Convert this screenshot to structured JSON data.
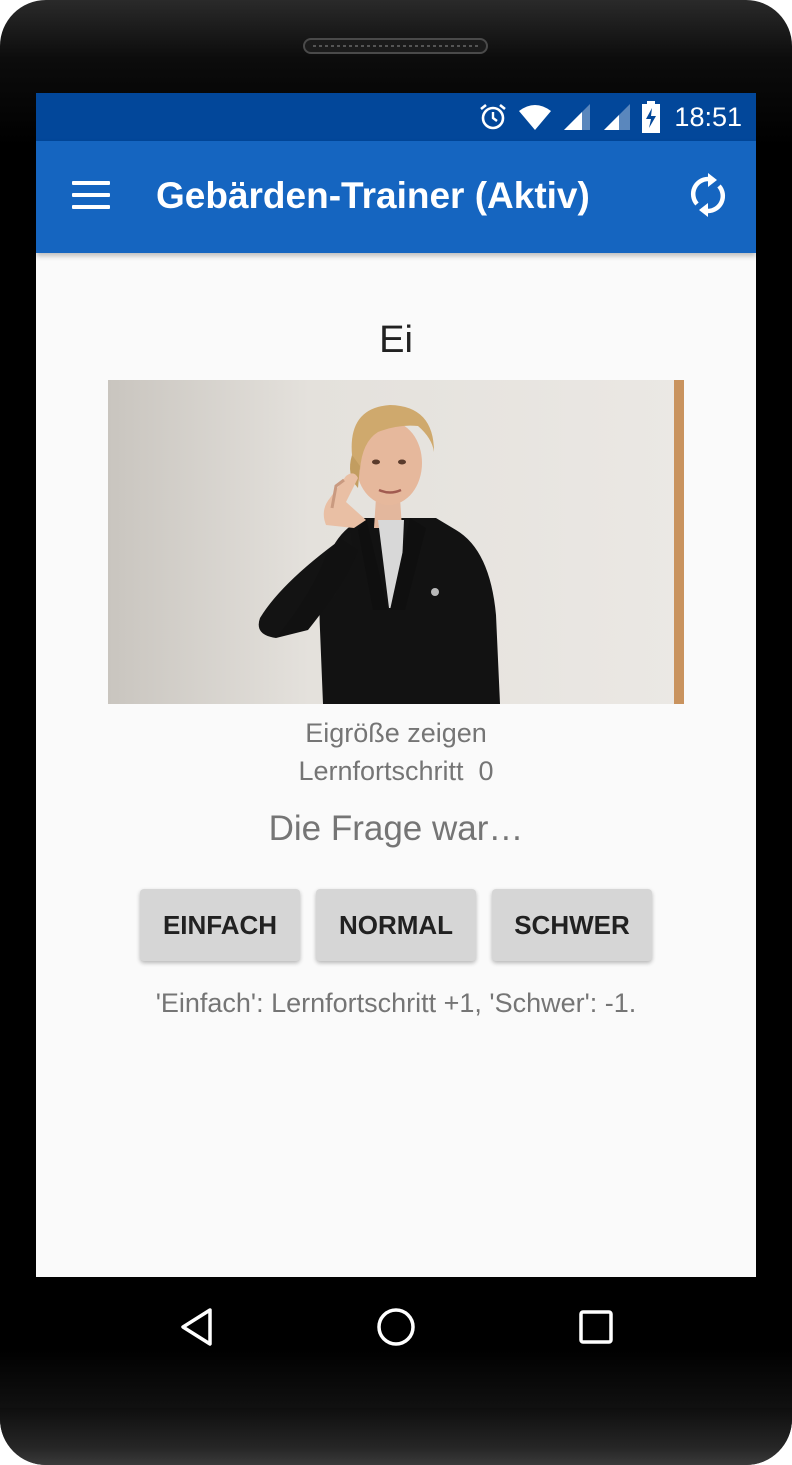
{
  "status_bar": {
    "time": "18:51",
    "icons": [
      "alarm-icon",
      "wifi-icon",
      "signal-icon",
      "signal-icon",
      "battery-charging-icon"
    ]
  },
  "app_bar": {
    "title": "Gebärden-Trainer (Aktiv)",
    "menu_icon": "hamburger-menu-icon",
    "action_icon": "sync-icon"
  },
  "card": {
    "word": "Ei",
    "video_description_icon": "sign-language-video",
    "meaning": "Eigröße zeigen",
    "progress_label": "Lernfortschritt",
    "progress_value": "0",
    "question": "Die Frage war…",
    "buttons": [
      "EINFACH",
      "NORMAL",
      "SCHWER"
    ],
    "hint": "'Einfach': Lernfortschritt +1, 'Schwer': -1."
  },
  "nav_bar": {
    "icons": [
      "back-icon",
      "home-icon",
      "recents-icon"
    ]
  },
  "colors": {
    "status_bar": "#02479a",
    "app_bar": "#1565c0",
    "button_bg": "#d6d6d6",
    "secondary_text": "#757575"
  }
}
